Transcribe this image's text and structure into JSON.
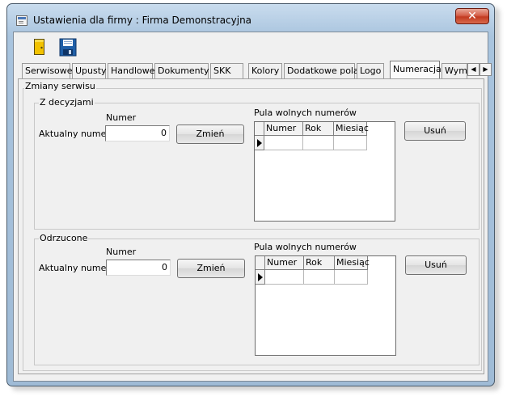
{
  "window": {
    "title": "Ustawienia dla firmy  : Firma Demonstracyjna",
    "close": "✕"
  },
  "tabs": [
    "Serwisowe",
    "Upusty",
    "Handlowe",
    "Dokumenty",
    "SKK",
    "Kolory",
    "Dodatkowe pola",
    "Logo",
    "Numeracja",
    "Wyma"
  ],
  "active_tab": "Numeracja",
  "tab_arrows": {
    "left": "◀",
    "right": "▶"
  },
  "panel": {
    "group_title": "Zmiany serwisu",
    "sections": [
      {
        "title": "Z decyzjami",
        "number_header": "Numer",
        "current_label": "Aktualny numer:",
        "current_value": "0",
        "change_button": "Zmień",
        "pool_label": "Pula wolnych numerów",
        "columns": [
          "Numer",
          "Rok",
          "Miesiąc"
        ],
        "delete_button": "Usuń"
      },
      {
        "title": "Odrzucone",
        "number_header": "Numer",
        "current_label": "Aktualny numer:",
        "current_value": "0",
        "change_button": "Zmień",
        "pool_label": "Pula wolnych numerów",
        "columns": [
          "Numer",
          "Rok",
          "Miesiąc"
        ],
        "delete_button": "Usuń"
      }
    ]
  },
  "colors": {
    "accent_blue": "#1f5fa8",
    "exit_yellow": "#f2c200",
    "close_red": "#c23b20"
  }
}
